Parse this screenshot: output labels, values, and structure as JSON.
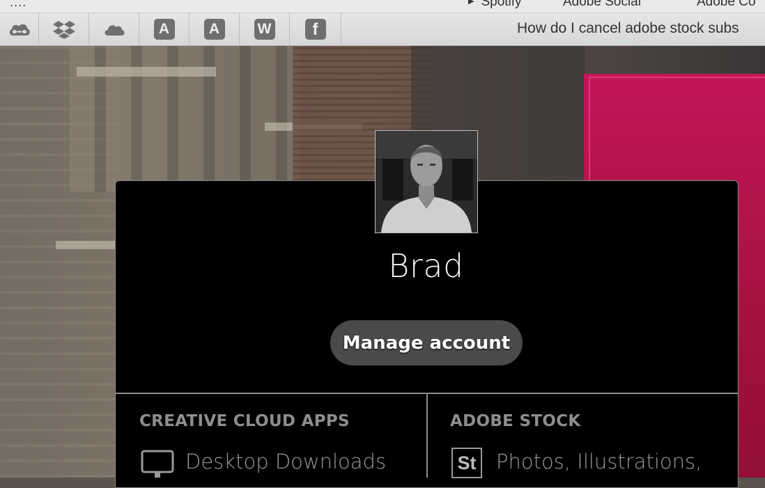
{
  "bookmarks_bar": {
    "dots": "....",
    "items": [
      {
        "label": "Spotify"
      },
      {
        "label": "Adobe Social"
      },
      {
        "label": "Adobe Co"
      }
    ]
  },
  "toolbar": {
    "extensions": [
      {
        "icon": "creative-cloud-icon"
      },
      {
        "icon": "dropbox-icon"
      },
      {
        "icon": "cloud-icon"
      },
      {
        "icon": "letter-a-icon",
        "glyph": "A"
      },
      {
        "icon": "letter-a-icon",
        "glyph": "A"
      },
      {
        "icon": "letter-w-icon",
        "glyph": "W"
      },
      {
        "icon": "facebook-icon",
        "glyph": "f"
      }
    ],
    "tab_title": "How do I cancel adobe stock subs"
  },
  "account_popup": {
    "user_name": "Brad",
    "manage_label": "Manage account",
    "sections": [
      {
        "heading": "CREATIVE CLOUD APPS",
        "item": "Desktop Downloads",
        "icon": "monitor-icon"
      },
      {
        "heading": "ADOBE STOCK",
        "item": "Photos, Illustrations,",
        "icon": "adobe-stock-icon",
        "icon_text": "St"
      }
    ]
  },
  "colors": {
    "popup_bg": "#000000",
    "button_bg": "#4a4a4a",
    "section_heading": "#8e8e8e",
    "accent_pink": "#c2165a"
  }
}
